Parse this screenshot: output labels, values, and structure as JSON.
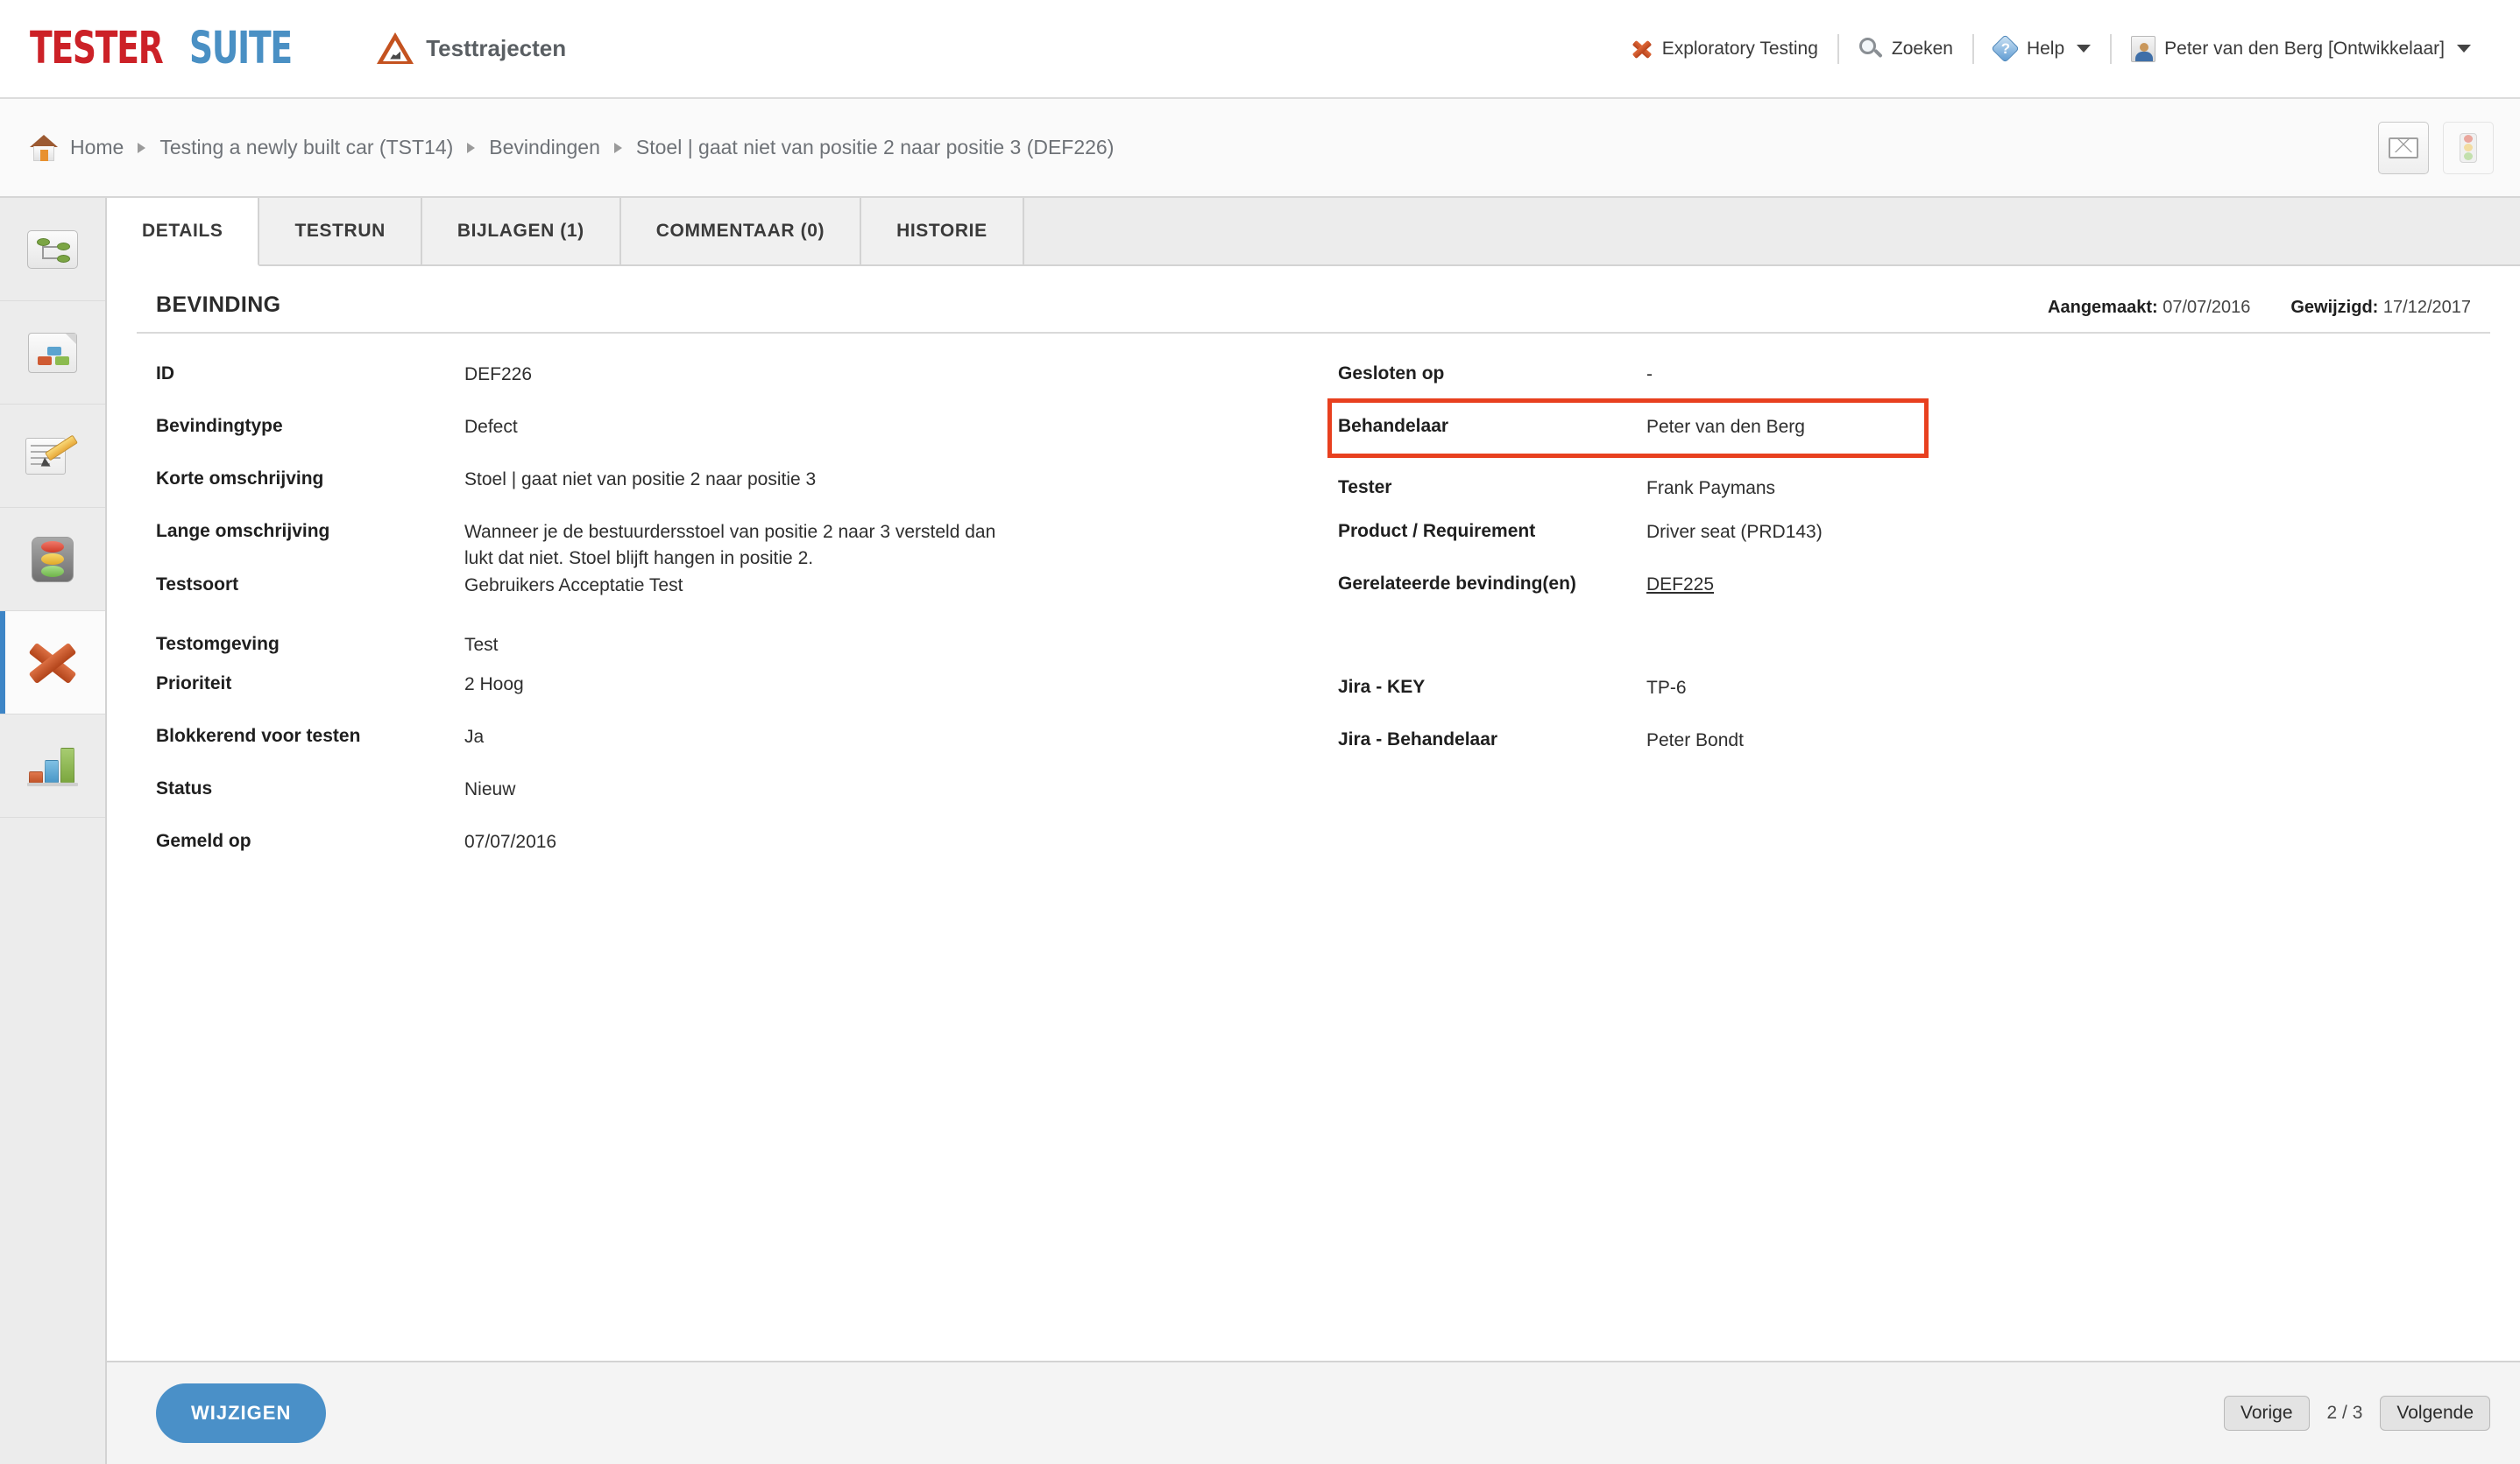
{
  "header": {
    "logo": {
      "part1": "TESTER",
      "part2": "SUITE"
    },
    "module_label": "Testtrajecten",
    "module_icon": "roadworks-triangle-icon",
    "nav": [
      {
        "label": "Exploratory Testing",
        "icon": "orange-x-icon",
        "caret": false
      },
      {
        "label": "Zoeken",
        "icon": "search-icon",
        "caret": false
      },
      {
        "label": "Help",
        "icon": "help-icon",
        "caret": true
      },
      {
        "label": "Peter van den Berg [Ontwikkelaar]",
        "icon": "avatar-icon",
        "caret": true
      }
    ]
  },
  "breadcrumb": {
    "home_icon": "home-icon",
    "items": [
      "Home",
      "Testing a newly built car (TST14)",
      "Bevindingen",
      "Stoel | gaat niet van positie 2 naar positie 3 (DEF226)"
    ],
    "actions": [
      {
        "icon": "envelope-icon",
        "name": "email-button"
      },
      {
        "icon": "traffic-light-icon",
        "name": "status-button"
      }
    ]
  },
  "sidebar": {
    "items": [
      {
        "icon": "tree-structure-icon",
        "name": "sidebar-item-structure",
        "active": false
      },
      {
        "icon": "document-blocks-icon",
        "name": "sidebar-item-documents",
        "active": false
      },
      {
        "icon": "edit-document-icon",
        "name": "sidebar-item-testcases",
        "active": false
      },
      {
        "icon": "traffic-light-icon",
        "name": "sidebar-item-testruns",
        "active": false
      },
      {
        "icon": "orange-x-icon",
        "name": "sidebar-item-bevindingen",
        "active": true
      },
      {
        "icon": "bar-chart-icon",
        "name": "sidebar-item-reports",
        "active": false
      }
    ]
  },
  "tabs": [
    {
      "label": "DETAILS",
      "active": true
    },
    {
      "label": "TESTRUN",
      "active": false
    },
    {
      "label": "BIJLAGEN (1)",
      "active": false
    },
    {
      "label": "COMMENTAAR (0)",
      "active": false
    },
    {
      "label": "HISTORIE",
      "active": false
    }
  ],
  "section": {
    "title": "BEVINDING",
    "created_label": "Aangemaakt:",
    "created_value": "07/07/2016",
    "modified_label": "Gewijzigd:",
    "modified_value": "17/12/2017"
  },
  "left_fields": [
    {
      "label": "ID",
      "value": "DEF226"
    },
    {
      "label": "Bevindingtype",
      "value": "Defect"
    },
    {
      "label": "Korte omschrijving",
      "value": "Stoel | gaat niet van positie 2 naar positie 3"
    },
    {
      "label": "Lange omschrijving",
      "value": "Wanneer je de bestuurdersstoel van positie 2 naar 3 versteld dan lukt dat niet. Stoel blijft hangen in positie 2."
    },
    {
      "label": "Testsoort",
      "value": "Gebruikers Acceptatie Test"
    },
    {
      "label": "Testomgeving",
      "value": "Test"
    },
    {
      "label": "Prioriteit",
      "value": "2 Hoog"
    },
    {
      "label": "Blokkerend voor testen",
      "value": "Ja"
    },
    {
      "label": "Status",
      "value": "Nieuw"
    },
    {
      "label": "Gemeld op",
      "value": "07/07/2016"
    }
  ],
  "right_fields": [
    {
      "label": "Gesloten op",
      "value": "-",
      "highlighted": false,
      "link": false
    },
    {
      "label": "Behandelaar",
      "value": "Peter van den Berg",
      "highlighted": true,
      "link": false
    },
    {
      "label": "Tester",
      "value": "Frank Paymans",
      "highlighted": false,
      "link": false
    },
    {
      "label": "Product / Requirement",
      "value": "Driver seat (PRD143)",
      "highlighted": false,
      "link": false
    },
    {
      "label": "Gerelateerde bevinding(en)",
      "value": "DEF225",
      "highlighted": false,
      "link": true
    },
    {
      "label": "Jira - KEY",
      "value": "TP-6",
      "highlighted": false,
      "link": false
    },
    {
      "label": "Jira - Behandelaar",
      "value": "Peter Bondt",
      "highlighted": false,
      "link": false
    }
  ],
  "footer": {
    "edit_label": "WIJZIGEN",
    "prev_label": "Vorige",
    "next_label": "Volgende",
    "page_count": "2 / 3"
  },
  "colors": {
    "logo_red": "#cc2127",
    "logo_blue": "#4a90c4",
    "highlight_red": "#e8401f",
    "primary_blue": "#4a90c8",
    "active_marker": "#3d85c6"
  }
}
